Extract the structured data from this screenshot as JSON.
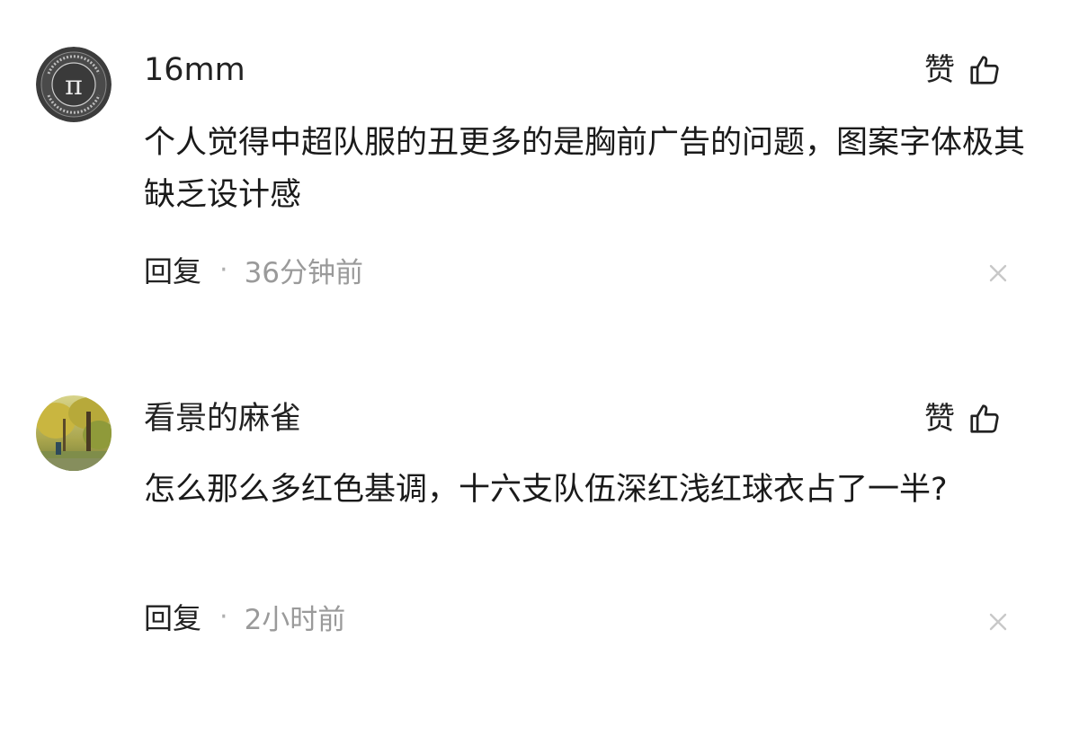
{
  "comments": [
    {
      "username": "16mm",
      "like_label": "赞",
      "text": "个人觉得中超队服的丑更多的是胸前广告的问题，图案字体极其缺乏设计感",
      "reply_label": "回复",
      "separator": "·",
      "time": "36分钟前",
      "avatar_icon": "pi-logo-avatar",
      "colors": {
        "avatar_bg": "#3c3c3c"
      }
    },
    {
      "username": "看景的麻雀",
      "like_label": "赞",
      "text": "怎么那么多红色基调，十六支队伍深红浅红球衣占了一半?",
      "reply_label": "回复",
      "separator": "·",
      "time": "2小时前",
      "avatar_icon": "landscape-photo-avatar",
      "colors": {
        "avatar_bg": "#9aa04a"
      }
    }
  ],
  "icons": {
    "like": "thumbs-up-icon",
    "close": "close-icon"
  },
  "colors": {
    "text_primary": "#222222",
    "text_secondary": "#9a9a9a",
    "icon_gray": "#c8c8c8"
  }
}
